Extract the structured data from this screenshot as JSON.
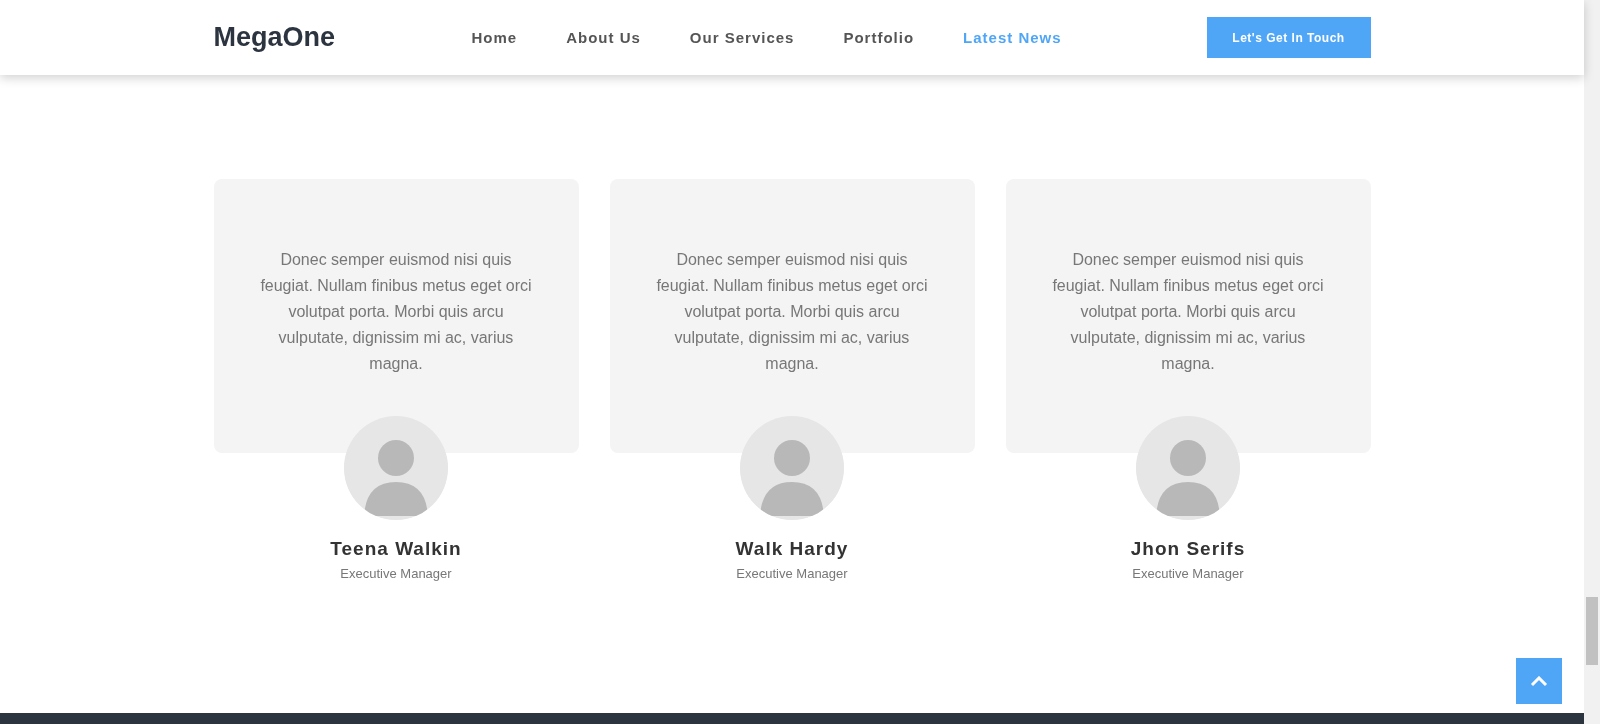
{
  "header": {
    "logo": "MegaOne",
    "nav": [
      {
        "label": "Home",
        "selected": false
      },
      {
        "label": "About Us",
        "selected": false
      },
      {
        "label": "Our Services",
        "selected": false
      },
      {
        "label": "Portfolio",
        "selected": false
      },
      {
        "label": "Latest News",
        "selected": true
      }
    ],
    "cta": "Let's Get In Touch"
  },
  "team": [
    {
      "quote": "Donec semper euismod nisi quis feugiat. Nullam finibus metus eget orci volutpat porta. Morbi quis arcu vulputate, dignissim mi ac, varius magna.",
      "name": "Teena Walkin",
      "role": "Executive Manager"
    },
    {
      "quote": "Donec semper euismod nisi quis feugiat. Nullam finibus metus eget orci volutpat porta. Morbi quis arcu vulputate, dignissim mi ac, varius magna.",
      "name": "Walk Hardy",
      "role": "Executive Manager"
    },
    {
      "quote": "Donec semper euismod nisi quis feugiat. Nullam finibus metus eget orci volutpat porta. Morbi quis arcu vulputate, dignissim mi ac, varius magna.",
      "name": "Jhon Serifs",
      "role": "Executive Manager"
    }
  ]
}
